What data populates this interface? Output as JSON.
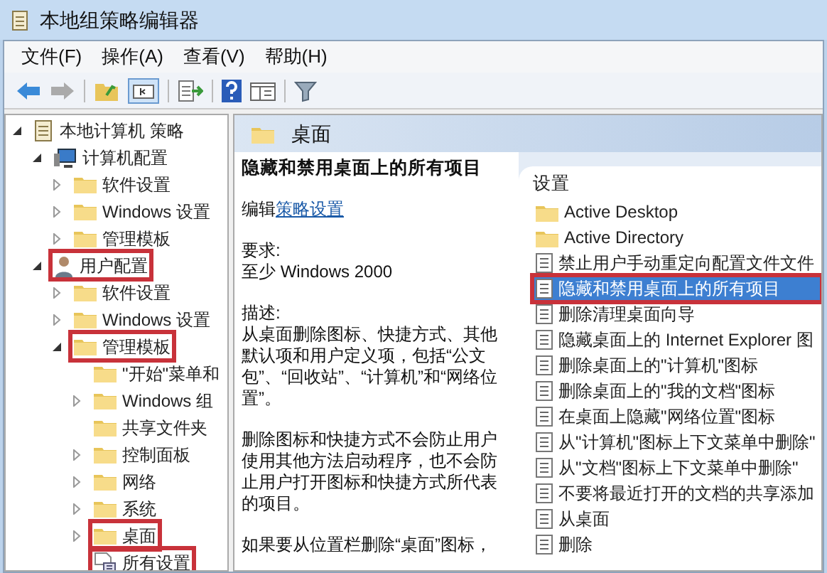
{
  "window": {
    "title": "本地组策略编辑器"
  },
  "menu": [
    "文件(F)",
    "操作(A)",
    "查看(V)",
    "帮助(H)"
  ],
  "tree": [
    {
      "label": "本地计算机 策略",
      "kind": "policy",
      "highlighted": false,
      "expanded": true,
      "children": [
        {
          "label": "计算机配置",
          "kind": "computer",
          "highlighted": false,
          "expanded": true,
          "children": [
            {
              "label": "软件设置",
              "kind": "folder",
              "highlighted": false,
              "expanded": false,
              "expandable": true
            },
            {
              "label": "Windows 设置",
              "kind": "folder",
              "highlighted": false,
              "expanded": false,
              "expandable": true
            },
            {
              "label": "管理模板",
              "kind": "folder",
              "highlighted": false,
              "expanded": false,
              "expandable": true
            }
          ]
        },
        {
          "label": "用户配置",
          "kind": "user",
          "highlighted": true,
          "expanded": true,
          "children": [
            {
              "label": "软件设置",
              "kind": "folder",
              "highlighted": false,
              "expanded": false,
              "expandable": true
            },
            {
              "label": "Windows 设置",
              "kind": "folder",
              "highlighted": false,
              "expanded": false,
              "expandable": true
            },
            {
              "label": "管理模板",
              "kind": "folder",
              "highlighted": true,
              "expanded": true,
              "children": [
                {
                  "label": "\"开始\"菜单和",
                  "kind": "folder",
                  "highlighted": false,
                  "expandable": false
                },
                {
                  "label": "Windows 组",
                  "kind": "folder",
                  "highlighted": false,
                  "expanded": false,
                  "expandable": true
                },
                {
                  "label": "共享文件夹",
                  "kind": "folder",
                  "highlighted": false,
                  "expandable": false
                },
                {
                  "label": "控制面板",
                  "kind": "folder",
                  "highlighted": false,
                  "expanded": false,
                  "expandable": true
                },
                {
                  "label": "网络",
                  "kind": "folder",
                  "highlighted": false,
                  "expanded": false,
                  "expandable": true
                },
                {
                  "label": "系统",
                  "kind": "folder",
                  "highlighted": false,
                  "expanded": false,
                  "expandable": true
                },
                {
                  "label": "桌面",
                  "kind": "folder",
                  "highlighted": true,
                  "expanded": false,
                  "expandable": true
                },
                {
                  "label": "所有设置",
                  "kind": "settings",
                  "highlighted": true,
                  "expandable": false
                }
              ]
            }
          ]
        }
      ]
    }
  ],
  "header": {
    "title": "桌面"
  },
  "detail": {
    "title": "隐藏和禁用桌面上的所有项目",
    "edit_prefix": "编辑",
    "edit_link": "策略设置",
    "requirement_label": "要求:",
    "requirement": "至少 Windows 2000",
    "description_label": "描述:",
    "paragraphs": [
      "从桌面删除图标、快捷方式、其他默认项和用户定义项，包括“公文包”、“回收站”、“计算机”和“网络位置”。",
      "删除图标和快捷方式不会防止用户使用其他方法启动程序，也不会防止用户打开图标和快捷方式所代表的项目。",
      "如果要从位置栏删除“桌面”图标，"
    ]
  },
  "list": {
    "column": "设置",
    "items": [
      {
        "label": "Active Desktop",
        "kind": "folder",
        "selected": false,
        "highlighted": false
      },
      {
        "label": "Active Directory",
        "kind": "folder",
        "selected": false,
        "highlighted": false
      },
      {
        "label": "禁止用户手动重定向配置文件文件",
        "kind": "setting",
        "selected": false,
        "highlighted": false
      },
      {
        "label": "隐藏和禁用桌面上的所有项目",
        "kind": "setting",
        "selected": true,
        "highlighted": true
      },
      {
        "label": "删除清理桌面向导",
        "kind": "setting",
        "selected": false,
        "highlighted": false
      },
      {
        "label": "隐藏桌面上的 Internet Explorer 图",
        "kind": "setting",
        "selected": false,
        "highlighted": false
      },
      {
        "label": "删除桌面上的\"计算机\"图标",
        "kind": "setting",
        "selected": false,
        "highlighted": false
      },
      {
        "label": "删除桌面上的\"我的文档\"图标",
        "kind": "setting",
        "selected": false,
        "highlighted": false
      },
      {
        "label": "在桌面上隐藏\"网络位置\"图标",
        "kind": "setting",
        "selected": false,
        "highlighted": false
      },
      {
        "label": "从\"计算机\"图标上下文菜单中删除\"",
        "kind": "setting",
        "selected": false,
        "highlighted": false
      },
      {
        "label": "从\"文档\"图标上下文菜单中删除\"",
        "kind": "setting",
        "selected": false,
        "highlighted": false
      },
      {
        "label": "不要将最近打开的文档的共享添加",
        "kind": "setting",
        "selected": false,
        "highlighted": false
      },
      {
        "label": "从桌面",
        "kind": "setting",
        "selected": false,
        "highlighted": false
      },
      {
        "label": "删除",
        "kind": "setting",
        "selected": false,
        "highlighted": false
      }
    ]
  }
}
